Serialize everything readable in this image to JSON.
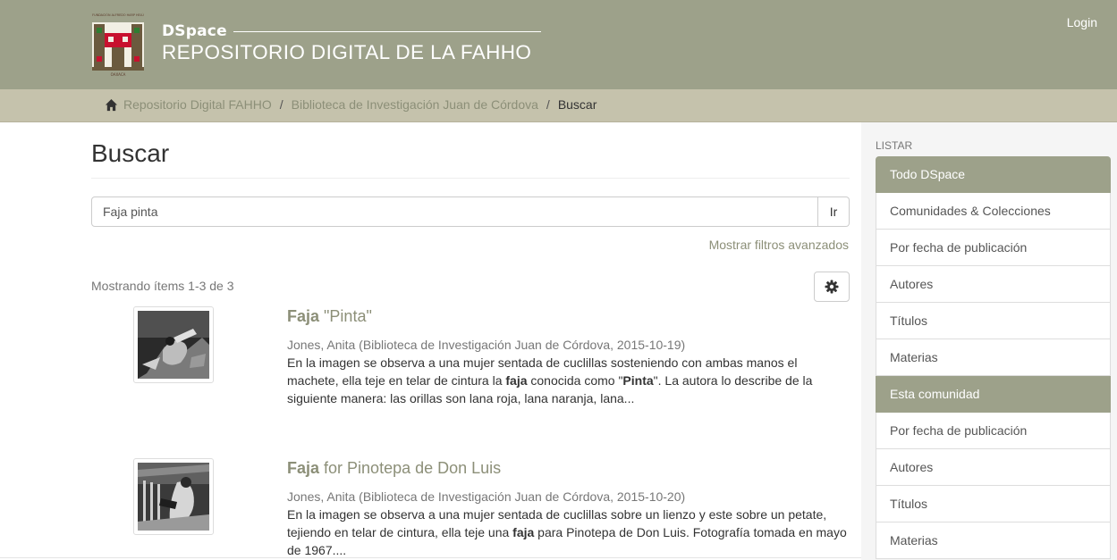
{
  "header": {
    "brand_small": "DSpace",
    "brand_title": "REPOSITORIO DIGITAL DE LA FAHHO",
    "logo_text_top": "FUNDACIÓN ALFREDO HARP HELÚ",
    "logo_text_bottom": "OAXACA",
    "login_label": "Login",
    "colors": {
      "header_bg": "#9da18a",
      "accent_link": "#8c8f78",
      "breadcrumb_bg": "#c5c2ac"
    }
  },
  "breadcrumb": {
    "home_icon": "home-icon",
    "items": [
      "Repositorio Digital FAHHO",
      "Biblioteca de Investigación Juan de Córdova"
    ],
    "separator": "/",
    "current": "Buscar"
  },
  "main": {
    "title": "Buscar",
    "search": {
      "value": "Faja pinta",
      "button_label": "Ir"
    },
    "advanced_filters_label": "Mostrar filtros avanzados",
    "showing_label": "Mostrando ítems 1-3 de 3",
    "settings_icon": "gear-icon",
    "results": [
      {
        "title_bold": "Faja",
        "title_rest": " \"Pinta\"",
        "meta": "Jones, Anita (Biblioteca de Investigación Juan de Córdova, 2015-10-19)",
        "abstract_parts": [
          "En la imagen se observa a una mujer sentada de cuclillas sosteniendo con ambas manos el machete, ella teje en telar de cintura la ",
          "faja",
          " conocida como \"",
          "Pinta",
          "\". La autora lo describe de la siguiente manera: las orillas son lana roja, lana naranja, lana..."
        ]
      },
      {
        "title_bold": "Faja",
        "title_rest": " for Pinotepa de Don Luis",
        "meta": "Jones, Anita (Biblioteca de Investigación Juan de Córdova, 2015-10-20)",
        "abstract_parts": [
          "En la imagen se observa a una mujer sentada de cuclillas sobre un lienzo y este sobre un petate, tejiendo en telar de cintura, ella teje una ",
          "faja",
          " para Pinotepa de Don Luis. Fotografía tomada en mayo de 1967...."
        ]
      }
    ]
  },
  "sidebar": {
    "heading": "LISTAR",
    "section1_title": "Todo DSpace",
    "section1_items": [
      "Comunidades & Colecciones",
      "Por fecha de publicación",
      "Autores",
      "Títulos",
      "Materias"
    ],
    "section2_title": "Esta comunidad",
    "section2_items": [
      "Por fecha de publicación",
      "Autores",
      "Títulos",
      "Materias"
    ]
  }
}
